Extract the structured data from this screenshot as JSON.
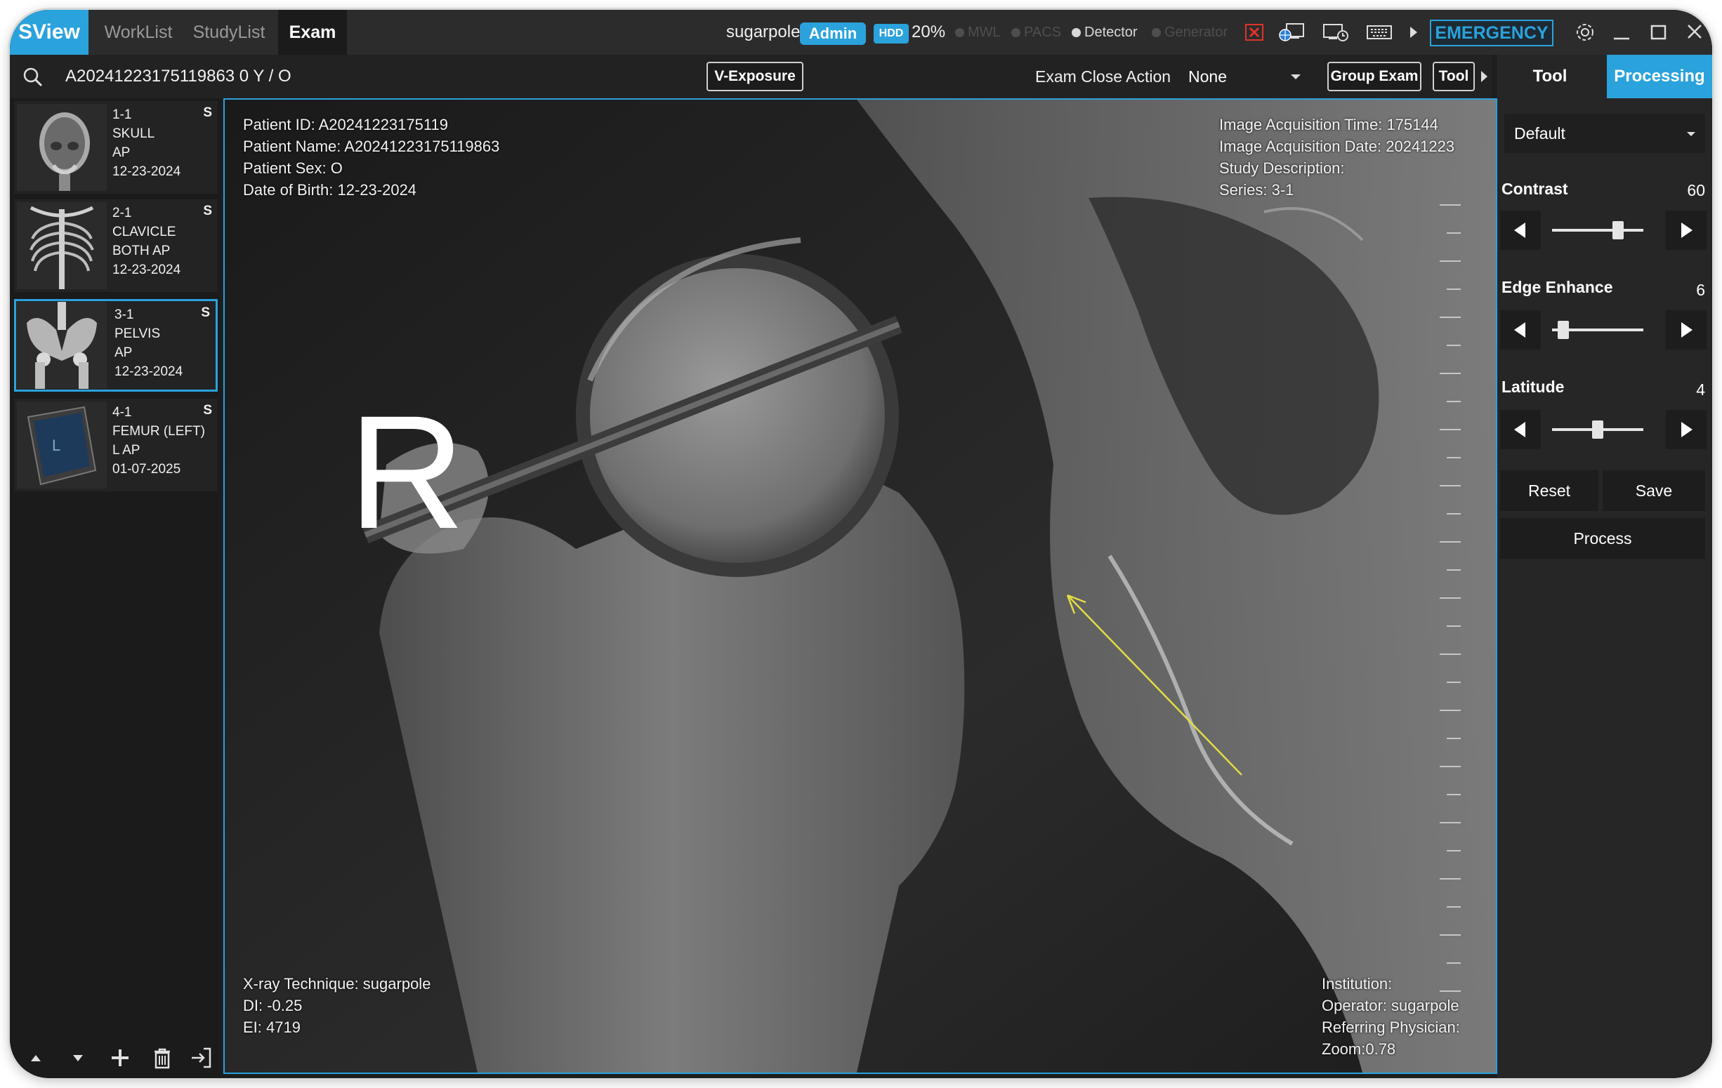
{
  "app": {
    "brand": "SView",
    "nav_tabs": [
      {
        "label": "WorkList"
      },
      {
        "label": "StudyList"
      },
      {
        "label": "Exam"
      }
    ],
    "user": "sugarpole",
    "role_badge": "Admin",
    "hdd_badge": "HDD",
    "hdd_usage": "20%",
    "status_indicators": [
      {
        "label": "MWL",
        "state": "inactive"
      },
      {
        "label": "PACS",
        "state": "inactive"
      },
      {
        "label": "Detector",
        "state": "active"
      },
      {
        "label": "Generator",
        "state": "inactive"
      }
    ],
    "emergency_label": "EMERGENCY",
    "colors": {
      "accent": "#2aa2dc",
      "error": "#e0332c",
      "annotation_arrow": "#e3dc43"
    }
  },
  "toolbar": {
    "patient_summary": "A20241223175119863  0 Y / O",
    "v_exposure_label": "V-Exposure",
    "exam_close_label": "Exam Close Action",
    "exam_close_value": "None",
    "group_exam_label": "Group Exam",
    "tool_label": "Tool"
  },
  "series_list": [
    {
      "id": "1-1",
      "body_part": "SKULL",
      "view": "AP",
      "date": "12-23-2024",
      "flag": "S",
      "thumb": "skull",
      "selected": false
    },
    {
      "id": "2-1",
      "body_part": "CLAVICLE",
      "view": "BOTH AP",
      "date": "12-23-2024",
      "flag": "S",
      "thumb": "chest",
      "selected": false
    },
    {
      "id": "3-1",
      "body_part": "PELVIS",
      "view": "AP",
      "date": "12-23-2024",
      "flag": "S",
      "thumb": "pelvis",
      "selected": true
    },
    {
      "id": "4-1",
      "body_part": "FEMUR (LEFT)",
      "view": "L AP",
      "date": "01-07-2025",
      "flag": "S",
      "thumb": "femur",
      "selected": false
    }
  ],
  "viewer": {
    "top_left": [
      "Patient ID: A20241223175119",
      "Patient Name: A20241223175119863",
      "Patient Sex: O",
      "Date of Birth: 12-23-2024"
    ],
    "top_right": [
      "Image Acquisition Time: 175144",
      "Image Acquisition Date: 20241223",
      "Study Description:",
      "Series: 3-1"
    ],
    "bottom_left": [
      "X-ray Technique: sugarpole",
      "DI: -0.25",
      "EI: 4719"
    ],
    "bottom_right": [
      "Institution:",
      "Operator: sugarpole",
      "Referring Physician:",
      "Zoom:0.78"
    ],
    "orientation_marker": "R"
  },
  "processing": {
    "tabs": [
      {
        "label": "Tool"
      },
      {
        "label": "Processing"
      }
    ],
    "preset": "Default",
    "params": [
      {
        "label": "Contrast",
        "value": "60",
        "level": 0.72
      },
      {
        "label": "Edge Enhance",
        "value": "6",
        "level": 0.12
      },
      {
        "label": "Latitude",
        "value": "4",
        "level": 0.5
      }
    ],
    "reset_label": "Reset",
    "save_label": "Save",
    "process_label": "Process"
  }
}
